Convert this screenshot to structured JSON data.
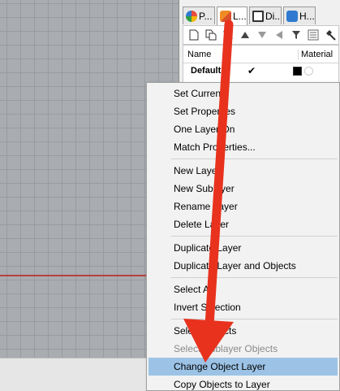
{
  "tabs": [
    {
      "label": "P...",
      "icon": "properties-icon",
      "color": "#7a4fbf"
    },
    {
      "label": "L...",
      "icon": "layers-icon",
      "color": "#d9502a"
    },
    {
      "label": "Di...",
      "icon": "display-icon",
      "color": "#3a6ea5"
    },
    {
      "label": "H...",
      "icon": "help-icon",
      "color": "#2f7ad0"
    }
  ],
  "layer_table": {
    "col_name": "Name",
    "col_material": "Material",
    "rows": [
      {
        "name": "Default",
        "current": "✔",
        "color": "#000000"
      }
    ]
  },
  "context_menu": {
    "groups": [
      [
        {
          "label": "Set Current"
        },
        {
          "label": "Set Properties"
        },
        {
          "label": "One Layer On"
        },
        {
          "label": "Match Properties..."
        }
      ],
      [
        {
          "label": "New Layer"
        },
        {
          "label": "New Sublayer"
        },
        {
          "label": "Rename Layer"
        },
        {
          "label": "Delete Layer"
        }
      ],
      [
        {
          "label": "Duplicate Layer"
        },
        {
          "label": "Duplicate Layer and Objects"
        }
      ],
      [
        {
          "label": "Select All"
        },
        {
          "label": "Invert Selection"
        }
      ],
      [
        {
          "label": "Select Objects"
        },
        {
          "label": "Select Sublayer Objects",
          "disabled": true
        },
        {
          "label": "Change Object Layer",
          "highlighted": true
        },
        {
          "label": "Copy Objects to Layer"
        }
      ]
    ]
  },
  "colors": {
    "highlight": "#9cc3e6",
    "arrow": "#e8321e",
    "redline": "#b5423f"
  }
}
